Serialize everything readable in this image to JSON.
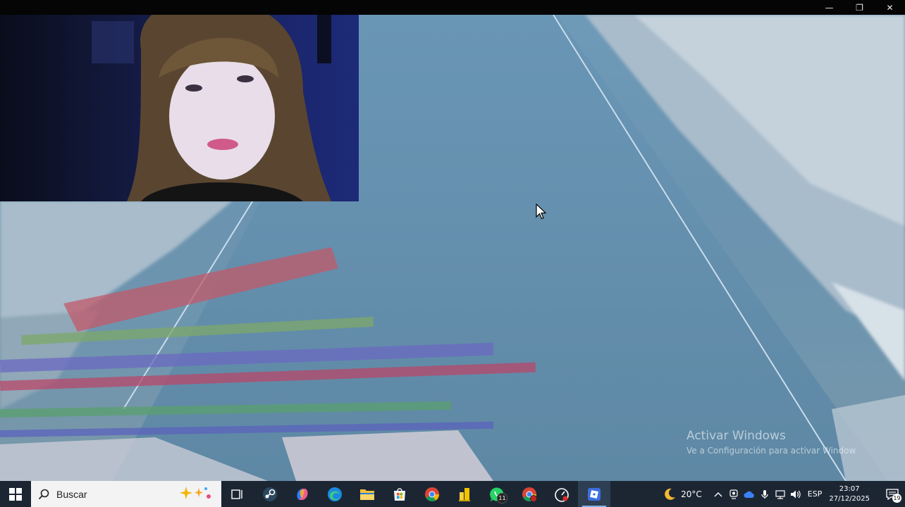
{
  "window": {
    "minimize_glyph": "—",
    "restore_glyph": "❐",
    "close_glyph": "✕"
  },
  "watermark": {
    "title": "Activar Windows",
    "subtitle": "Ve a Configuración para activar Windows."
  },
  "taskbar": {
    "search_label": "Buscar",
    "pinned": [
      {
        "name": "task-view-icon"
      },
      {
        "name": "steam-icon"
      },
      {
        "name": "copilot-icon"
      },
      {
        "name": "edge-icon"
      },
      {
        "name": "file-explorer-icon"
      },
      {
        "name": "microsoft-store-icon"
      },
      {
        "name": "chrome-icon"
      },
      {
        "name": "folder-yellow-icon"
      },
      {
        "name": "whatsapp-icon",
        "badge": "11"
      },
      {
        "name": "chrome-profile-icon"
      },
      {
        "name": "speedometer-icon"
      },
      {
        "name": "roblox-icon",
        "active": true
      }
    ],
    "whatsapp_badge": "11",
    "weather_temp": "20°C",
    "language": "ESP",
    "time": "23:07",
    "date": "27/12/2025",
    "notification_count": "19"
  },
  "colors": {
    "taskbar": "#1c2633",
    "active_indicator": "#7fb3e6",
    "game_sky": "#6e9ab8"
  }
}
